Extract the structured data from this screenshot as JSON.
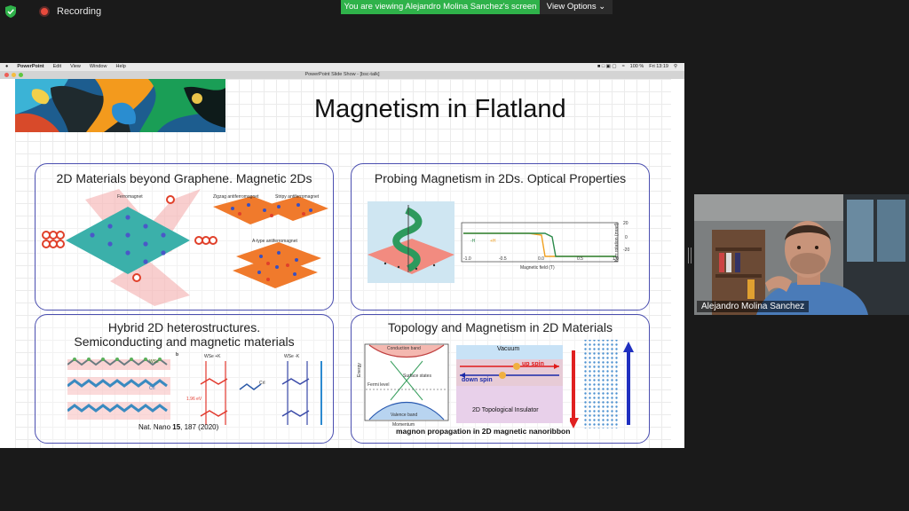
{
  "meeting": {
    "recording_label": "Recording",
    "viewing_banner": "You are viewing Alejandro Molina Sanchez's screen",
    "view_options_label": "View Options"
  },
  "mac_menu": {
    "app": "PowerPoint",
    "items": [
      "Edit",
      "View",
      "Window",
      "Help"
    ],
    "battery": "100 %",
    "clock": "Fri 13:19"
  },
  "window": {
    "title": "PowerPoint Slide Show - [bsc-talk]"
  },
  "slide": {
    "title": "Magnetism in Flatland",
    "panels": {
      "top_left": {
        "title": "2D Materials beyond Graphene. Magnetic 2Ds",
        "labels": [
          "Ferromagnet",
          "Zigzag antiferromagnet",
          "Stripy antiferromagnet",
          "A-type antiferromagnet"
        ]
      },
      "top_right": {
        "title": "Probing Magnetism in 2Ds. Optical Properties",
        "plot": {
          "xlabel": "Magnetic field (T)",
          "ylabel": "Kerr rotation (mrad)",
          "xticks": [
            "-1.0",
            "-0.5",
            "0.0",
            "0.5",
            "1.0"
          ],
          "yticks": [
            "20",
            "0",
            "-20"
          ],
          "legend": [
            "-H",
            "+H"
          ]
        }
      },
      "bottom_left": {
        "title_line1": "Hybrid 2D heterostructures.",
        "title_line2": "Semiconducting and magnetic materials",
        "citation_prefix": "Nat. Nano ",
        "citation_volume": "15",
        "citation_suffix": ", 187 (2020)",
        "labels": [
          "WSe",
          "CrI",
          "b",
          "WSe +K",
          "WSe -K",
          "1.96 eV",
          "CrI"
        ]
      },
      "bottom_right": {
        "title": "Topology and Magnetism in 2D Materials",
        "band_labels": [
          "Conduction band",
          "Surface states",
          "Fermi level",
          "Valence band",
          "Energy",
          "Momentum"
        ],
        "ti_labels": {
          "vacuum": "Vacuum",
          "up_spin": "up spin",
          "down_spin": "down spin",
          "ti": "2D Topological Insulator"
        },
        "caption": "magnon propagation in 2D magnetic nanoribbon"
      }
    }
  },
  "camera": {
    "participant_name": "Alejandro Molina Sanchez"
  }
}
